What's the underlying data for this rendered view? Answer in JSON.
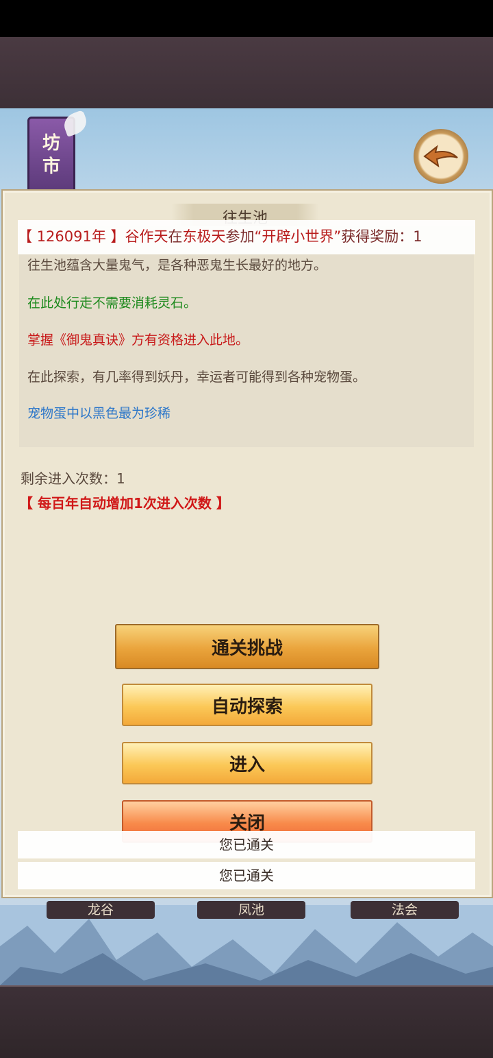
{
  "header": {
    "shop_label_1": "坊",
    "shop_label_2": "市"
  },
  "panel": {
    "title": "往生池",
    "descriptions": [
      "往生池蕴含大量鬼气，是各种恶鬼生长最好的地方。",
      "在此处行走不需要消耗灵石。",
      "掌握《御鬼真诀》方有资格进入此地。",
      "在此探索，有几率得到妖丹，幸运者可能得到各种宠物蛋。",
      "宠物蛋中以黑色最为珍稀"
    ],
    "remaining_label": "剩余进入次数：1",
    "remaining_note": "【 每百年自动增加1次进入次数 】"
  },
  "marquee": {
    "year": "【 126091年 】",
    "name": "谷作天",
    "mid1": "在",
    "place": "东极天",
    "mid2": "参加",
    "event": "“开辟小世界”",
    "tail": "获得奖励：1"
  },
  "buttons": {
    "challenge": "通关挑战",
    "auto": "自动探索",
    "enter": "进入",
    "close": "关闭"
  },
  "toasts": [
    "您已通关",
    "您已通关"
  ],
  "tabs": [
    "龙谷",
    "凤池",
    "法会"
  ],
  "icons": {
    "back": "back-arrow-icon",
    "sign": "shop-sign-icon"
  },
  "colors": {
    "green": "#1e8a1e",
    "red": "#c81a1a",
    "blue": "#2b76c9"
  }
}
